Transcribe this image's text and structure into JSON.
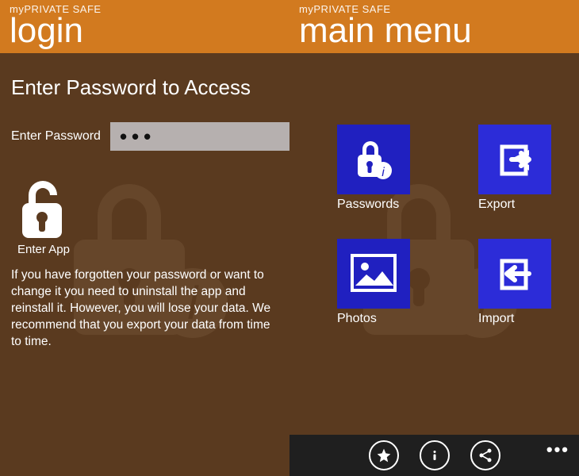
{
  "colors": {
    "header": "#d27a1f",
    "body": "#5a3a1f",
    "tile_a": "#2020c0",
    "tile_b": "#2c2cd8",
    "appbar": "#1f1f1f"
  },
  "login": {
    "app_name": "myPRIVATE SAFE",
    "page_title": "login",
    "instruction": "Enter Password to Access",
    "pw_label": "Enter Password",
    "pw_value": "•••",
    "enter_label": "Enter App",
    "note": "If you have forgotten your password or want to change it you need to uninstall the app and reinstall it. However, you will lose your data. We recommend that you export your data from time to time."
  },
  "menu": {
    "app_name": "myPRIVATE SAFE",
    "page_title": "main menu",
    "tiles": [
      {
        "label": "Passwords",
        "icon": "lock-info-icon"
      },
      {
        "label": "Export",
        "icon": "export-icon"
      },
      {
        "label": "Photos",
        "icon": "photo-icon"
      },
      {
        "label": "Import",
        "icon": "import-icon"
      }
    ],
    "appbar": [
      {
        "icon": "star-icon"
      },
      {
        "icon": "info-icon"
      },
      {
        "icon": "share-icon"
      }
    ],
    "more": "•••"
  }
}
